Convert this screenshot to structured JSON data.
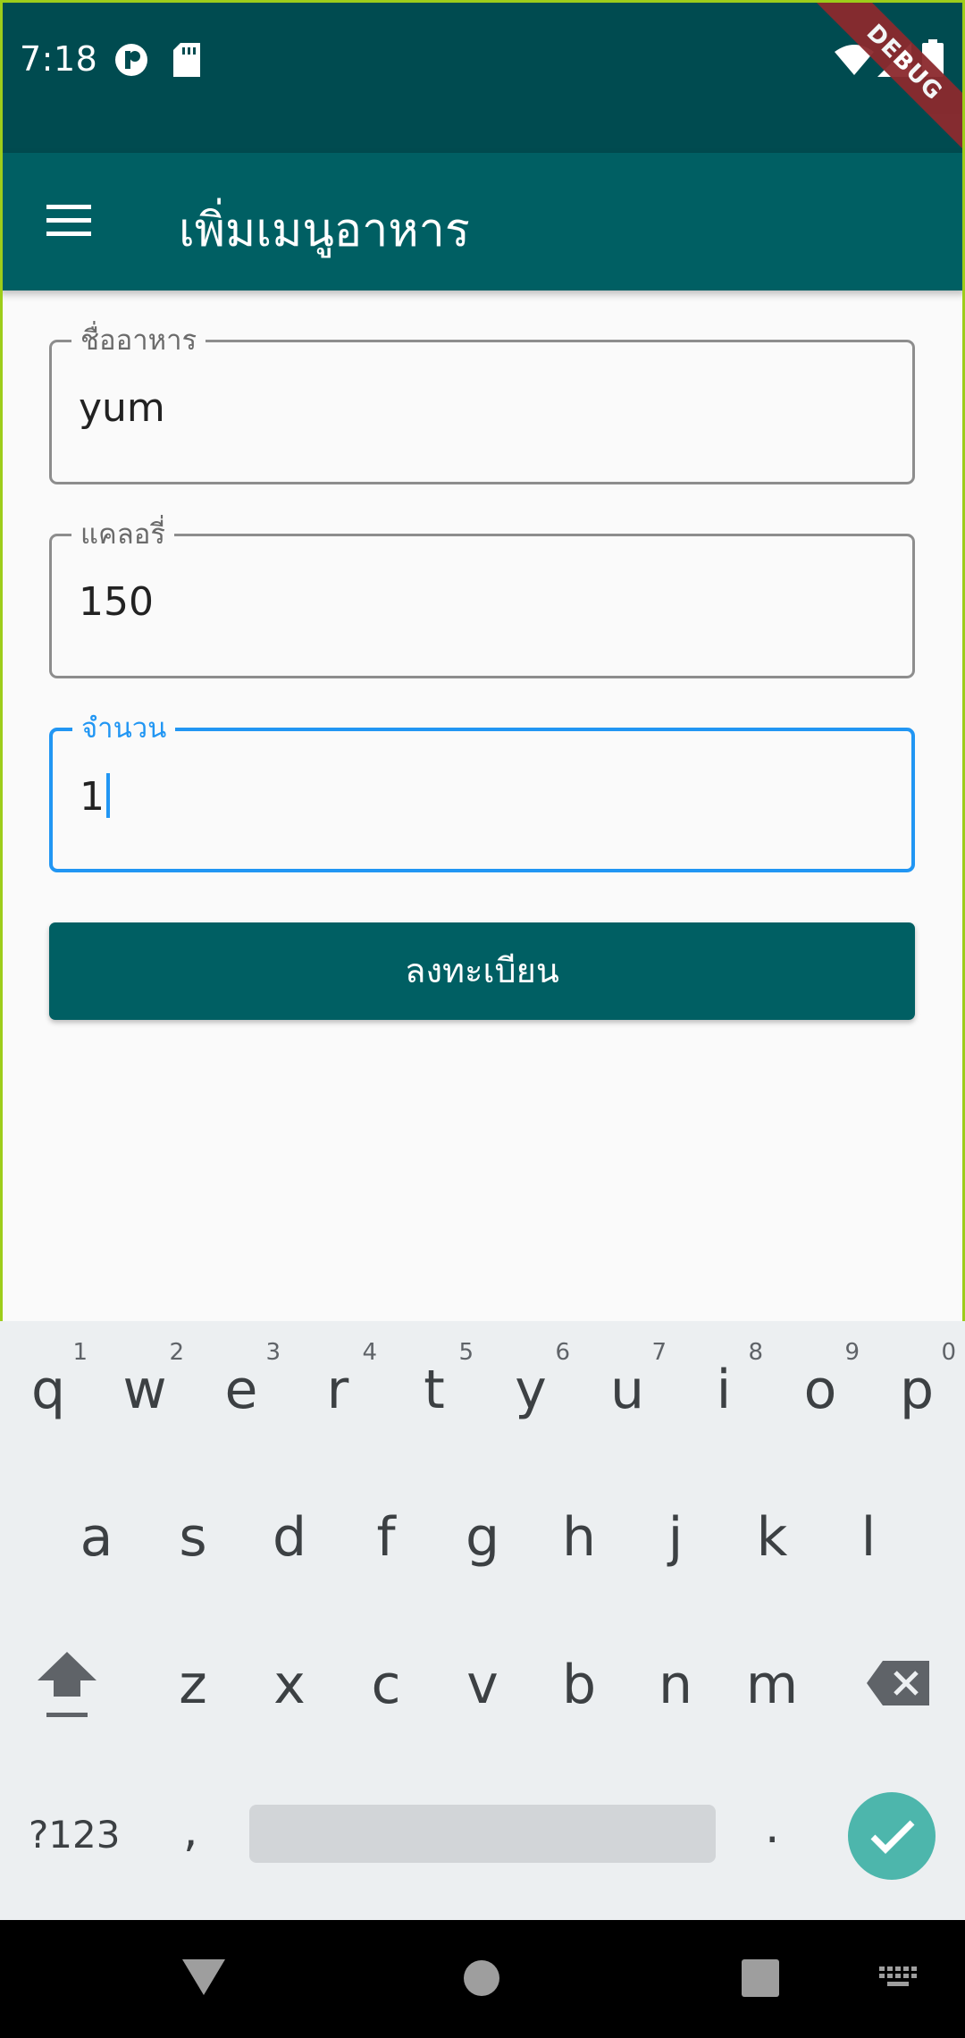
{
  "status_bar": {
    "time": "7:18",
    "icons": [
      "notification-icon",
      "sd-card-icon",
      "wifi-icon",
      "signal-icon",
      "battery-icon"
    ],
    "debug_banner": "DEBUG"
  },
  "app_bar": {
    "title": "เพิ่มเมนูอาหาร",
    "menu_icon": "menu-icon"
  },
  "form": {
    "fields": [
      {
        "label": "ชื่ออาหาร",
        "value": "yum",
        "focused": false
      },
      {
        "label": "แคลอรี่",
        "value": "150",
        "focused": false
      },
      {
        "label": "จำนวน",
        "value": "1",
        "focused": true
      }
    ],
    "submit_label": "ลงทะเบียน"
  },
  "keyboard": {
    "row1": [
      {
        "key": "q",
        "num": "1"
      },
      {
        "key": "w",
        "num": "2"
      },
      {
        "key": "e",
        "num": "3"
      },
      {
        "key": "r",
        "num": "4"
      },
      {
        "key": "t",
        "num": "5"
      },
      {
        "key": "y",
        "num": "6"
      },
      {
        "key": "u",
        "num": "7"
      },
      {
        "key": "i",
        "num": "8"
      },
      {
        "key": "o",
        "num": "9"
      },
      {
        "key": "p",
        "num": "0"
      }
    ],
    "row2": [
      "a",
      "s",
      "d",
      "f",
      "g",
      "h",
      "j",
      "k",
      "l"
    ],
    "row3": [
      "z",
      "x",
      "c",
      "v",
      "b",
      "n",
      "m"
    ],
    "symbols_label": "?123",
    "comma": ",",
    "period": "."
  },
  "colors": {
    "status_bar": "#004b50",
    "app_bar": "#005f63",
    "focus": "#2196f3",
    "enter_key": "#4db6ac"
  }
}
